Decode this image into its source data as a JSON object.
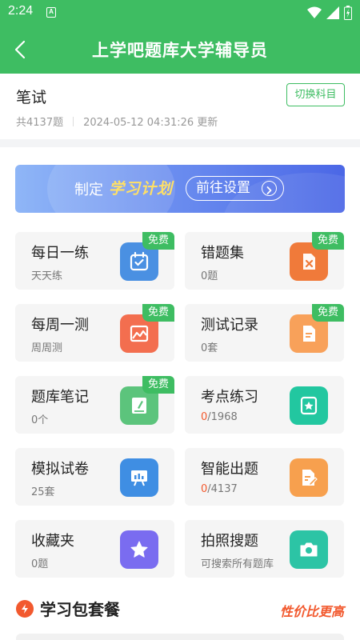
{
  "statusbar": {
    "time": "2:24",
    "app_badge": "A"
  },
  "appbar": {
    "title": "上学吧题库大学辅导员"
  },
  "subject": {
    "name": "笔试",
    "count": "共4137题",
    "updated": "2024-05-12 04:31:26 更新",
    "switch_label": "切换科目"
  },
  "banner": {
    "lead": "制定",
    "plan": "学习计划",
    "cta": "前往设置"
  },
  "colors": {
    "brand": "#3ebd62",
    "accent": "#f2592e"
  },
  "cards": [
    {
      "label": "每日一练",
      "sub": "天天练",
      "badge": "免费",
      "icon": "calendar-check-icon",
      "color": "#4a90e2"
    },
    {
      "label": "错题集",
      "sub": "0题",
      "badge": "免费",
      "icon": "wrong-doc-icon",
      "color": "#f07a3a"
    },
    {
      "label": "每周一测",
      "sub": "周周测",
      "badge": "免费",
      "icon": "image-chart-icon",
      "color": "#f36e4f"
    },
    {
      "label": "测试记录",
      "sub": "0套",
      "badge": "免费",
      "icon": "record-doc-icon",
      "color": "#f8a15a"
    },
    {
      "label": "题库笔记",
      "sub": "0个",
      "badge": "免费",
      "icon": "notebook-icon",
      "color": "#5cc47c"
    },
    {
      "label": "考点练习",
      "sub_hl": "0",
      "sub_rest": "/1968",
      "icon": "star-card-icon",
      "color": "#22c7a0"
    },
    {
      "label": "模拟试卷",
      "sub": "25套",
      "icon": "presentation-icon",
      "color": "#3f8ee3"
    },
    {
      "label": "智能出题",
      "sub_hl": "0",
      "sub_rest": "/4137",
      "icon": "doc-edit-icon",
      "color": "#f7a04e"
    },
    {
      "label": "收藏夹",
      "sub": "0题",
      "icon": "star-icon",
      "color": "#7a6cf0"
    },
    {
      "label": "拍照搜题",
      "sub": "可搜索所有题库",
      "icon": "camera-icon",
      "color": "#2cc4a5"
    }
  ],
  "package": {
    "title": "学习包套餐",
    "value_tag": "性价比更高"
  }
}
